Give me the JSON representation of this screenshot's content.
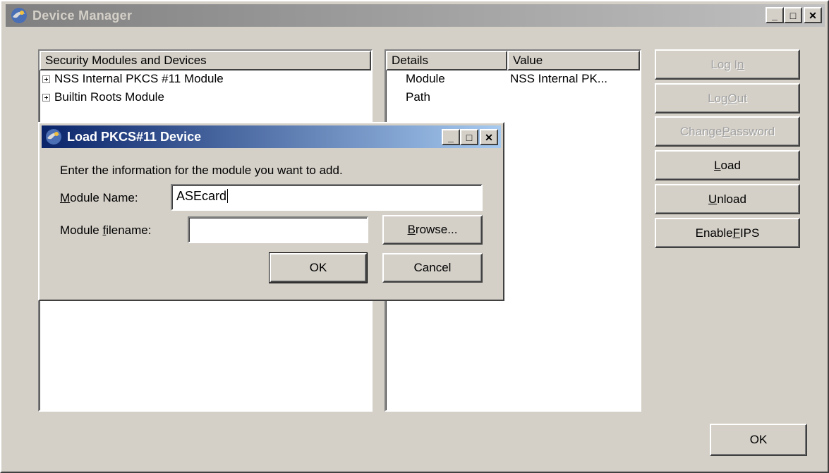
{
  "window": {
    "title": "Device Manager"
  },
  "modules_list": {
    "header": "Security Modules and Devices",
    "items": [
      {
        "label": "NSS Internal PKCS #11 Module"
      },
      {
        "label": "Builtin Roots Module"
      }
    ]
  },
  "details": {
    "col_details": "Details",
    "col_value": "Value",
    "rows": [
      {
        "name": "Module",
        "value": "NSS Internal PK..."
      },
      {
        "name": "Path",
        "value": ""
      }
    ]
  },
  "side_buttons": {
    "login": {
      "pre": "Log I",
      "key": "n",
      "post": ""
    },
    "logout": {
      "pre": "Log ",
      "key": "O",
      "post": "ut"
    },
    "change_password": {
      "pre": "Change ",
      "key": "P",
      "post": "assword"
    },
    "load": {
      "pre": "",
      "key": "L",
      "post": "oad"
    },
    "unload": {
      "pre": "",
      "key": "U",
      "post": "nload"
    },
    "enable_fips": {
      "pre": "Enable ",
      "key": "F",
      "post": "IPS"
    }
  },
  "ok_label": "OK",
  "dialog": {
    "title": "Load PKCS#11 Device",
    "instruction": "Enter the information for the module you want to add.",
    "module_name_label": {
      "pre": "",
      "key": "M",
      "post": "odule Name:"
    },
    "module_name_value": "ASEcard",
    "module_filename_label": {
      "pre": "Module ",
      "key": "f",
      "post": "ilename:"
    },
    "module_filename_value": "",
    "browse": {
      "pre": "",
      "key": "B",
      "post": "rowse..."
    },
    "ok_label": "OK",
    "cancel_label": "Cancel"
  }
}
